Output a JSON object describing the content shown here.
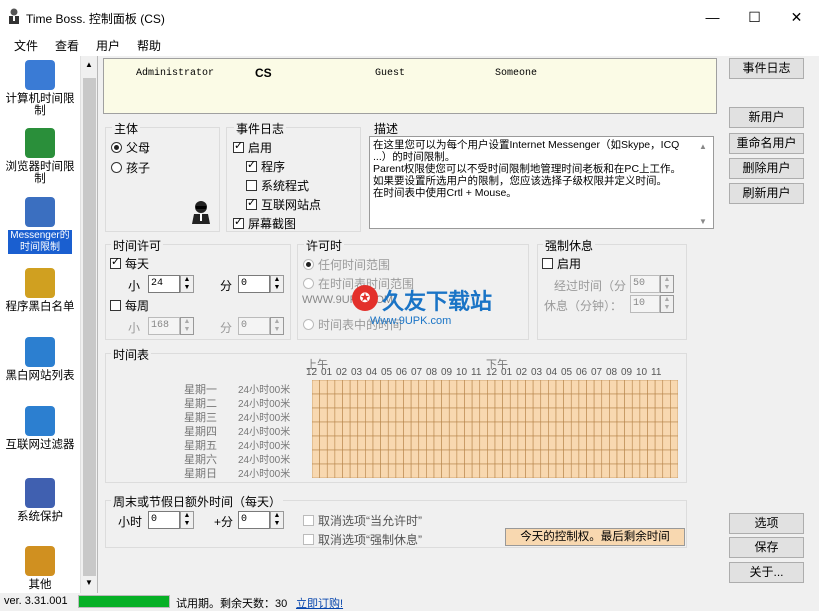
{
  "window": {
    "title": "Time Boss. 控制面板 (CS)",
    "minimize": "—",
    "maximize": "☐",
    "close": "✕"
  },
  "menu": [
    "文件",
    "查看",
    "用户",
    "帮助"
  ],
  "sidebar": [
    {
      "label": "计算机时间限制",
      "icon": "computer-clock-icon",
      "color": "#3a7bd5"
    },
    {
      "label": "浏览器时间限制",
      "icon": "browser-clock-icon",
      "color": "#2a8f3a"
    },
    {
      "label": "Messenger的时间限制",
      "icon": "messenger-icon",
      "color": "#3b6fc0"
    },
    {
      "label": "程序黑白名单",
      "icon": "program-list-icon",
      "color": "#d0a020"
    },
    {
      "label": "黑白网站列表",
      "icon": "web-list-icon",
      "color": "#2c7fd0"
    },
    {
      "label": "互联网过滤器",
      "icon": "internet-filter-icon",
      "color": "#2c7fd0"
    },
    {
      "label": "系统保护",
      "icon": "system-protect-icon",
      "color": "#4060b0"
    },
    {
      "label": "其他",
      "icon": "misc-icon",
      "color": "#d09020"
    }
  ],
  "users": [
    "Administrator",
    "CS",
    "Guest",
    "Someone"
  ],
  "right_buttons": {
    "event_log": "事件日志",
    "new_user": "新用户",
    "rename_user": "重命名用户",
    "delete_user": "删除用户",
    "refresh_users": "刷新用户",
    "options": "选项",
    "save": "保存",
    "about": "关于..."
  },
  "master": {
    "title": "主体",
    "parent": "父母",
    "child": "孩子"
  },
  "eventlog": {
    "title": "事件日志",
    "enable": "启用",
    "program": "程序",
    "system": "系统程式",
    "internet": "互联网站点",
    "screenshot": "屏幕截图"
  },
  "description": {
    "title": "描述",
    "text": "在这里您可以为每个用户设置Internet Messenger（如Skype，ICQ ...）的时间限制。\nParent权限使您可以不受时间限制地管理时间老板和在PC上工作。\n如果要设置所选用户的限制，您应该选择子级权限并定义时间。\n在时间表中使用Crtl + Mouse。"
  },
  "time_allow": {
    "title": "时间许可",
    "daily": "每天",
    "hour": "小",
    "hour_val": "24",
    "min": "分",
    "min_val": "0",
    "weekly": "每周",
    "whour_val": "168",
    "wmin_val": "0"
  },
  "allow_when": {
    "title": "许可时",
    "opt1": "任何时间范围",
    "opt2": "在时间表时间范围",
    "opt3": "时间表中的时间"
  },
  "forced_break": {
    "title": "强制休息",
    "enable": "启用",
    "elapsed": "经过时间（分",
    "elapsed_val": "50",
    "rest": "休息（分钟）：",
    "rest_val": "10"
  },
  "schedule": {
    "title": "时间表",
    "am": "上午",
    "pm": "下午",
    "hours": [
      "12",
      "01",
      "02",
      "03",
      "04",
      "05",
      "06",
      "07",
      "08",
      "09",
      "10",
      "11",
      "12",
      "01",
      "02",
      "03",
      "04",
      "05",
      "06",
      "07",
      "08",
      "09",
      "10",
      "11"
    ],
    "days": [
      "星期一",
      "星期二",
      "星期三",
      "星期四",
      "星期五",
      "星期六",
      "星期日"
    ],
    "daylabel": "24小时00米"
  },
  "extra": {
    "title": "周末或节假日额外时间（每天）",
    "hour": "小时",
    "hour_val": "0",
    "min": "+分",
    "min_val": "0",
    "cancel_allow": "取消选项“当允许时”",
    "cancel_break": "取消选项“强制休息”",
    "today": "今天的控制权。最后剩余时间"
  },
  "watermark": {
    "site": "WWW.9UPK.COM",
    "brand": "久友下载站",
    "url": "Www.9UPK.com"
  },
  "status": {
    "version": "ver. 3.31.001",
    "trial": "试用期。剩余天数：30",
    "order": "立即订购!",
    "progress": 1.0
  }
}
